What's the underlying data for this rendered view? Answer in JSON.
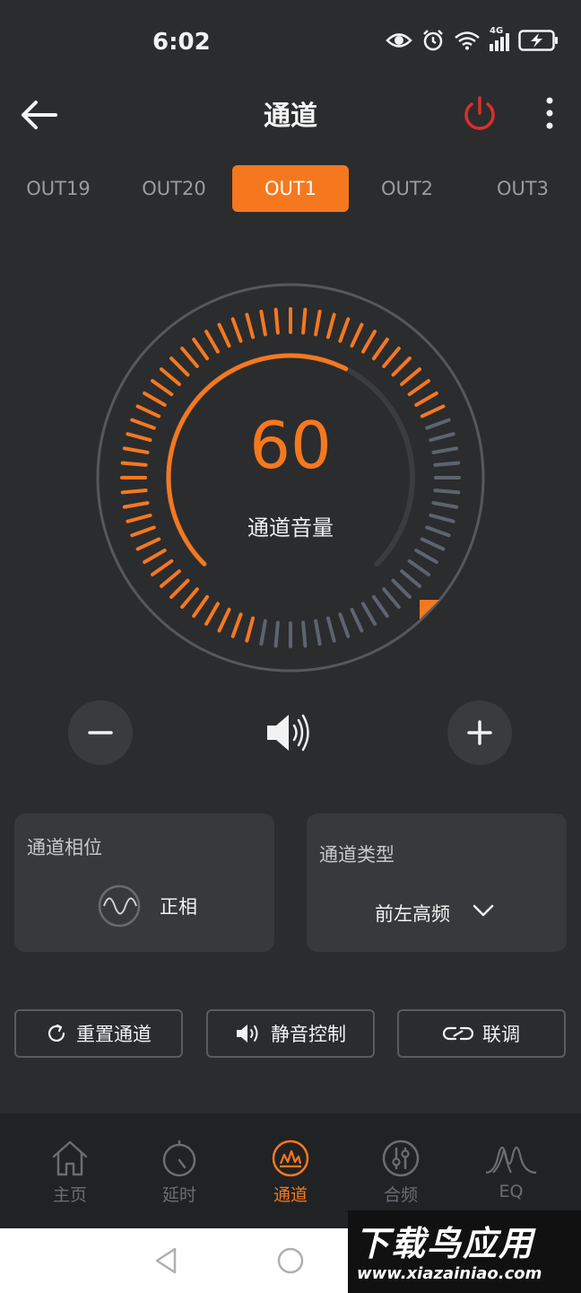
{
  "status_bar": {
    "time": "6:02",
    "network": "4G",
    "icons": [
      "eye-icon",
      "alarm-icon",
      "wifi-icon",
      "signal-icon",
      "battery-charging-icon"
    ]
  },
  "header": {
    "title": "通道",
    "back_icon": "arrow-left-icon",
    "power_icon": "power-icon",
    "more_icon": "more-vertical-icon",
    "power_color": "#d9302c"
  },
  "tabs": [
    {
      "label": "OUT19",
      "active": false
    },
    {
      "label": "OUT20",
      "active": false
    },
    {
      "label": "OUT1",
      "active": true
    },
    {
      "label": "OUT2",
      "active": false
    },
    {
      "label": "OUT3",
      "active": false
    }
  ],
  "dial": {
    "value": "60",
    "label": "通道音量",
    "level_fraction": 0.6,
    "accent": "#f5781f"
  },
  "volume_controls": {
    "minus_icon": "minus-icon",
    "speaker_icon": "speaker-icon",
    "plus_icon": "plus-icon"
  },
  "phase_card": {
    "title": "通道相位",
    "value": "正相",
    "icon": "sine-wave-icon"
  },
  "type_card": {
    "title": "通道类型",
    "value": "前左高频",
    "icon": "chevron-down-icon"
  },
  "actions": [
    {
      "label": "重置通道",
      "icon": "refresh-icon"
    },
    {
      "label": "静音控制",
      "icon": "speaker-icon"
    },
    {
      "label": "联调",
      "icon": "link-icon"
    }
  ],
  "bottom_nav": [
    {
      "label": "主页",
      "icon": "home-icon",
      "active": false
    },
    {
      "label": "延时",
      "icon": "timer-icon",
      "active": false
    },
    {
      "label": "通道",
      "icon": "channel-icon",
      "active": true
    },
    {
      "label": "合频",
      "icon": "mixer-icon",
      "active": false
    },
    {
      "label": "EQ",
      "icon": "eq-icon",
      "active": false
    }
  ],
  "watermark": {
    "main": "下载鸟应用",
    "sub": "www.xiazainiao.com"
  }
}
